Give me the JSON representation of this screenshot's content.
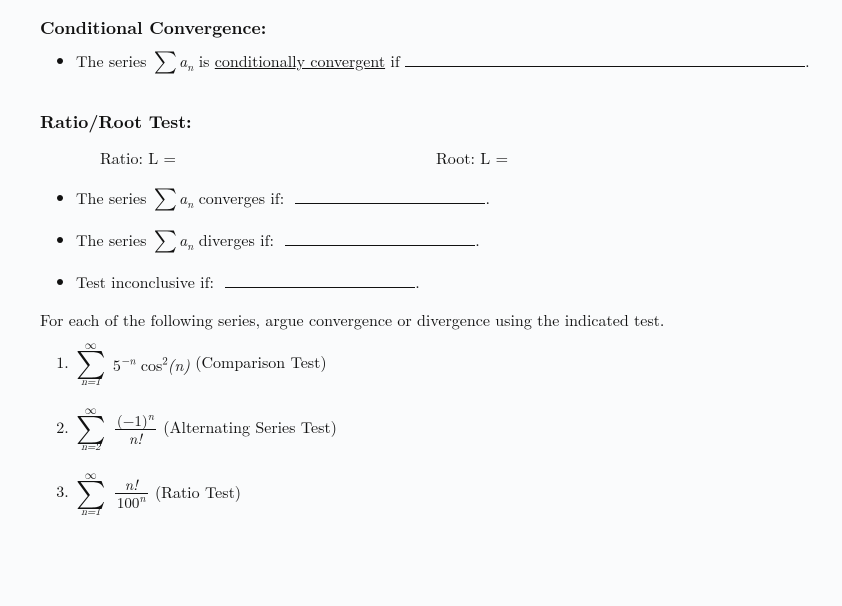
{
  "sections": {
    "conditional": {
      "heading": "Conditional Convergence:",
      "bullet": {
        "prefix": "The series",
        "sum_html": "∑ aₙ",
        "mid": "is",
        "underlined": "conditionally convergent",
        "after": "if"
      }
    },
    "ratioRoot": {
      "heading": "Ratio/Root Test:",
      "ratioLabel": "Ratio:  L =",
      "rootLabel": "Root:  L =",
      "bullets": {
        "converges": {
          "prefix": "The series",
          "after": "converges if:"
        },
        "diverges": {
          "prefix": "The series",
          "after": "diverges if:"
        },
        "inconclusive": "Test inconclusive if:"
      }
    },
    "intro": "For each of the following series, argue convergence or divergence using the indicated test.",
    "problems": {
      "p1": {
        "lower": "n=1",
        "upper": "∞",
        "summand_base": "5",
        "summand_exp": "−n",
        "summand_tail": " cos",
        "summand_exp2": "2",
        "summand_paren": "(n)",
        "label": "(Comparison Test)"
      },
      "p2": {
        "lower": "n=2",
        "upper": "∞",
        "num": "(−1)",
        "num_exp": "n",
        "den": "n!",
        "label": "(Alternating Series Test)"
      },
      "p3": {
        "lower": "n=1",
        "upper": "∞",
        "num": "n!",
        "den_base": "100",
        "den_exp": "n",
        "label": "(Ratio Test)"
      }
    }
  }
}
